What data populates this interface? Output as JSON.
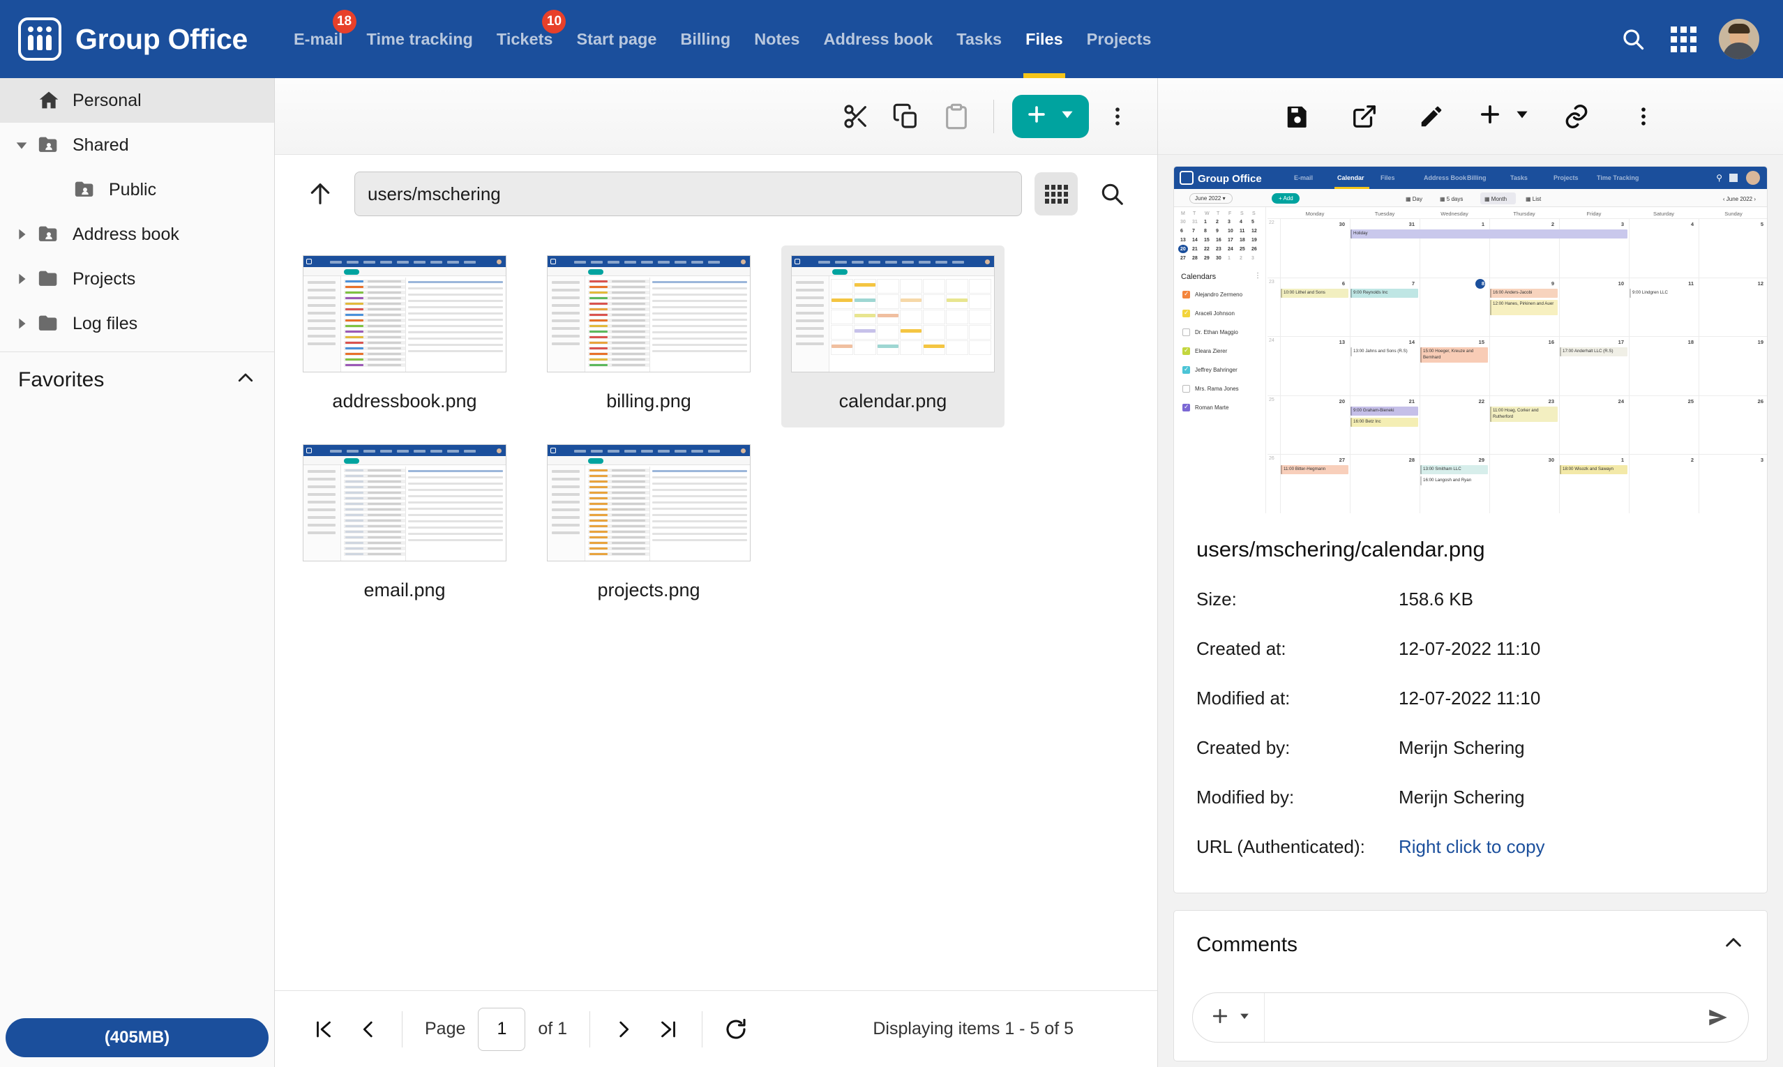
{
  "header": {
    "brand": "Group Office",
    "logo_icon": "group-office-logo",
    "nav": [
      {
        "label": "E-mail",
        "badge": "18",
        "active": false
      },
      {
        "label": "Time tracking",
        "badge": "",
        "active": false
      },
      {
        "label": "Tickets",
        "badge": "10",
        "active": false
      },
      {
        "label": "Start page",
        "badge": "",
        "active": false
      },
      {
        "label": "Billing",
        "badge": "",
        "active": false
      },
      {
        "label": "Notes",
        "badge": "",
        "active": false
      },
      {
        "label": "Address book",
        "badge": "",
        "active": false
      },
      {
        "label": "Tasks",
        "badge": "",
        "active": false
      },
      {
        "label": "Files",
        "badge": "",
        "active": true
      },
      {
        "label": "Projects",
        "badge": "",
        "active": false
      }
    ],
    "actions": [
      {
        "name": "search-icon",
        "label": "Search"
      },
      {
        "name": "apps-grid-icon",
        "label": "Applications"
      },
      {
        "name": "avatar",
        "label": "User profile"
      }
    ],
    "colors": {
      "background": "#1B4F9C",
      "active_underline": "#F5C518",
      "badge": "#E8402A"
    }
  },
  "sidebar": {
    "items": [
      {
        "label": "Personal",
        "icon": "home-icon",
        "indent": 0,
        "twisty": "",
        "selected": true
      },
      {
        "label": "Shared",
        "icon": "shared-folder-icon",
        "indent": 0,
        "twisty": "down",
        "selected": false
      },
      {
        "label": "Public",
        "icon": "shared-folder-icon",
        "indent": 1,
        "twisty": "",
        "selected": false
      },
      {
        "label": "Address book",
        "icon": "shared-folder-icon",
        "indent": 0,
        "twisty": "right",
        "selected": false
      },
      {
        "label": "Projects",
        "icon": "folder-icon",
        "indent": 0,
        "twisty": "right",
        "selected": false
      },
      {
        "label": "Log files",
        "icon": "folder-icon",
        "indent": 0,
        "twisty": "right",
        "selected": false
      }
    ],
    "favorites": {
      "title": "Favorites",
      "collapse_icon": "chevron-up-icon"
    },
    "quota": {
      "label": "(405MB)",
      "color": "#1B4F9C"
    }
  },
  "center": {
    "toolbar": [
      {
        "name": "cut-button",
        "label": "Cut",
        "icon": "scissors-icon",
        "disabled": false
      },
      {
        "name": "copy-button",
        "label": "Copy",
        "icon": "copy-icon",
        "disabled": false
      },
      {
        "name": "paste-button",
        "label": "Paste",
        "icon": "clipboard-icon",
        "disabled": true
      },
      {
        "name": "add-button",
        "label": "Add",
        "icon": "plus-icon",
        "disabled": false
      },
      {
        "name": "more-menu-button",
        "label": "More",
        "icon": "kebab-menu-icon",
        "disabled": false
      }
    ],
    "add_button_color": "#00A39F",
    "pathbar": {
      "up_label": "Up one level",
      "up_icon": "arrow-up-icon",
      "path_value": "users/mschering",
      "path_placeholder": "Path",
      "view_toggle_icon": "grid-view-icon",
      "view_toggle_label": "Grid view",
      "search_icon": "search-icon",
      "search_label": "Search files"
    },
    "files": [
      {
        "name": "addressbook.png",
        "thumb": "addressbook",
        "selected": false
      },
      {
        "name": "billing.png",
        "thumb": "billing",
        "selected": false
      },
      {
        "name": "calendar.png",
        "thumb": "calendar",
        "selected": true
      },
      {
        "name": "email.png",
        "thumb": "email",
        "selected": false
      },
      {
        "name": "projects.png",
        "thumb": "projects",
        "selected": false
      }
    ],
    "pager": {
      "first_icon": "first-page-icon",
      "prev_icon": "previous-page-icon",
      "page_label": "Page",
      "page_value": "1",
      "of_label": "of 1",
      "next_icon": "next-page-icon",
      "last_icon": "last-page-icon",
      "refresh_icon": "refresh-icon",
      "status": "Displaying items 1 - 5 of 5"
    }
  },
  "detail": {
    "toolbar": [
      {
        "name": "save-button",
        "label": "Save",
        "icon": "save-icon"
      },
      {
        "name": "open-external-button",
        "label": "Open",
        "icon": "external-link-icon"
      },
      {
        "name": "edit-button",
        "label": "Edit",
        "icon": "pencil-icon"
      },
      {
        "name": "add-button",
        "label": "Add",
        "icon": "plus-icon"
      },
      {
        "name": "link-button",
        "label": "Link",
        "icon": "chain-link-icon"
      },
      {
        "name": "more-menu-button",
        "label": "More",
        "icon": "kebab-menu-icon"
      }
    ],
    "preview_icon": "calendar-preview-image",
    "title": "users/mschering/calendar.png",
    "properties": [
      {
        "key": "Size:",
        "value": "158.6 KB",
        "link": false
      },
      {
        "key": "Created at:",
        "value": "12-07-2022 11:10",
        "link": false
      },
      {
        "key": "Modified at:",
        "value": "12-07-2022 11:10",
        "link": false
      },
      {
        "key": "Created by:",
        "value": "Merijn Schering",
        "link": false
      },
      {
        "key": "Modified by:",
        "value": "Merijn Schering",
        "link": false
      },
      {
        "key": "URL (Authenticated):",
        "value": "Right click to copy",
        "link": true
      }
    ],
    "comments": {
      "title": "Comments",
      "collapse_icon": "chevron-up-icon",
      "attach_icon": "plus-icon",
      "attach_dropdown_icon": "caret-down-icon",
      "input_value": "",
      "input_placeholder": "",
      "send_icon": "send-icon"
    }
  },
  "preview_content": {
    "brand": "Group Office",
    "nav": [
      "E-mail",
      "Calendar",
      "Files",
      "Address Book",
      "Billing",
      "Tasks",
      "Projects",
      "Time Tracking"
    ],
    "active_nav": "Calendar",
    "month_selector": "June 2022",
    "range_label": "June 2022",
    "add_label": "Add",
    "views": [
      "Day",
      "5 days",
      "Month",
      "List"
    ],
    "active_view": "Month",
    "weekday_headers": [
      "Monday",
      "Tuesday",
      "Wednesday",
      "Thursday",
      "Friday",
      "Saturday",
      "Sunday"
    ],
    "mini_weekday_headers": [
      "M",
      "T",
      "W",
      "T",
      "F",
      "S",
      "S"
    ],
    "mini_month_rows": [
      [
        "30",
        "31",
        "1",
        "2",
        "3",
        "4",
        "5"
      ],
      [
        "6",
        "7",
        "8",
        "9",
        "10",
        "11",
        "12"
      ],
      [
        "13",
        "14",
        "15",
        "16",
        "17",
        "18",
        "19"
      ],
      [
        "20",
        "21",
        "22",
        "23",
        "24",
        "25",
        "26"
      ],
      [
        "27",
        "28",
        "29",
        "30",
        "1",
        "2",
        "3"
      ]
    ],
    "mini_today": "20",
    "calendars_title": "Calendars",
    "calendars": [
      {
        "name": "Alejandro Zermeno",
        "color": "#F4853C",
        "checked": true
      },
      {
        "name": "Araceli Johnson",
        "color": "#F2D43C",
        "checked": true
      },
      {
        "name": "Dr. Ethan Maggio",
        "color": "#ffffff",
        "checked": false
      },
      {
        "name": "Eleara Zierer",
        "color": "#C3D63E",
        "checked": true
      },
      {
        "name": "Jeffrey Bahringer",
        "color": "#4BC4D6",
        "checked": true
      },
      {
        "name": "Mrs. Rama Jones",
        "color": "#ffffff",
        "checked": false
      },
      {
        "name": "Roman Marte",
        "color": "#7B68D4",
        "checked": true
      }
    ],
    "week_day_numbers": [
      [
        "30",
        "31",
        "1",
        "2",
        "3",
        "4",
        "5"
      ],
      [
        "6",
        "7",
        "8",
        "9",
        "10",
        "11",
        "12"
      ],
      [
        "13",
        "14",
        "15",
        "16",
        "17",
        "18",
        "19"
      ],
      [
        "20",
        "21",
        "22",
        "23",
        "24",
        "25",
        "26"
      ],
      [
        "27",
        "28",
        "29",
        "30",
        "1",
        "2",
        "3"
      ]
    ],
    "week_numbers": [
      "22",
      "23",
      "24",
      "25",
      "26"
    ],
    "events": [
      {
        "week": 0,
        "day": 1,
        "text": "Holiday",
        "color": "#c9c8ec",
        "span": 4
      },
      {
        "week": 1,
        "day": 0,
        "text": "10:00 Lithel and Sons",
        "color": "#f2efc0",
        "span": 1
      },
      {
        "week": 1,
        "day": 1,
        "text": "9:00 Reynolds Inc",
        "color": "#bfe6e4",
        "span": 1
      },
      {
        "week": 1,
        "day": 3,
        "text": "16:00 Anders-Jacobi",
        "color": "#f7d3bd",
        "span": 1
      },
      {
        "week": 1,
        "day": 3,
        "text": "12:00 Hanes, Pirkinen and Auer",
        "color": "#f7f0c0",
        "span": 1
      },
      {
        "week": 1,
        "day": 5,
        "text": "9:00 Lindgren LLC",
        "color": "#ffffff",
        "span": 1
      },
      {
        "week": 2,
        "day": 1,
        "text": "13:00 Jahns and Sons (R.S)",
        "color": "#ffffff",
        "span": 1
      },
      {
        "week": 2,
        "day": 2,
        "text": "15:00 Hoeger, Kreuze and Bernhard",
        "color": "#f8ccb6",
        "span": 1
      },
      {
        "week": 2,
        "day": 4,
        "text": "17:00 Anderhalt LLC (R.S)",
        "color": "#f0efe6",
        "span": 1
      },
      {
        "week": 3,
        "day": 1,
        "text": "9:00 Graham-Bieneki",
        "color": "#c5bfe8",
        "span": 1
      },
      {
        "week": 3,
        "day": 1,
        "text": "16:00 Betz Inc",
        "color": "#f4eeb4",
        "span": 1
      },
      {
        "week": 3,
        "day": 3,
        "text": "11:00 Hoag, Corker and Rutherford",
        "color": "#f3efc1",
        "span": 1
      },
      {
        "week": 4,
        "day": 0,
        "text": "11:00 Bitter-Hegmann",
        "color": "#f8cfbb",
        "span": 1
      },
      {
        "week": 4,
        "day": 2,
        "text": "13:00 Smitham LLC",
        "color": "#d7eeeb",
        "span": 1
      },
      {
        "week": 4,
        "day": 2,
        "text": "16:00 Langosh and Ryan",
        "color": "#ffffff",
        "span": 1
      },
      {
        "week": 4,
        "day": 4,
        "text": "18:00 Wisozk and Sawayn",
        "color": "#f3e9a8",
        "span": 1
      }
    ]
  }
}
